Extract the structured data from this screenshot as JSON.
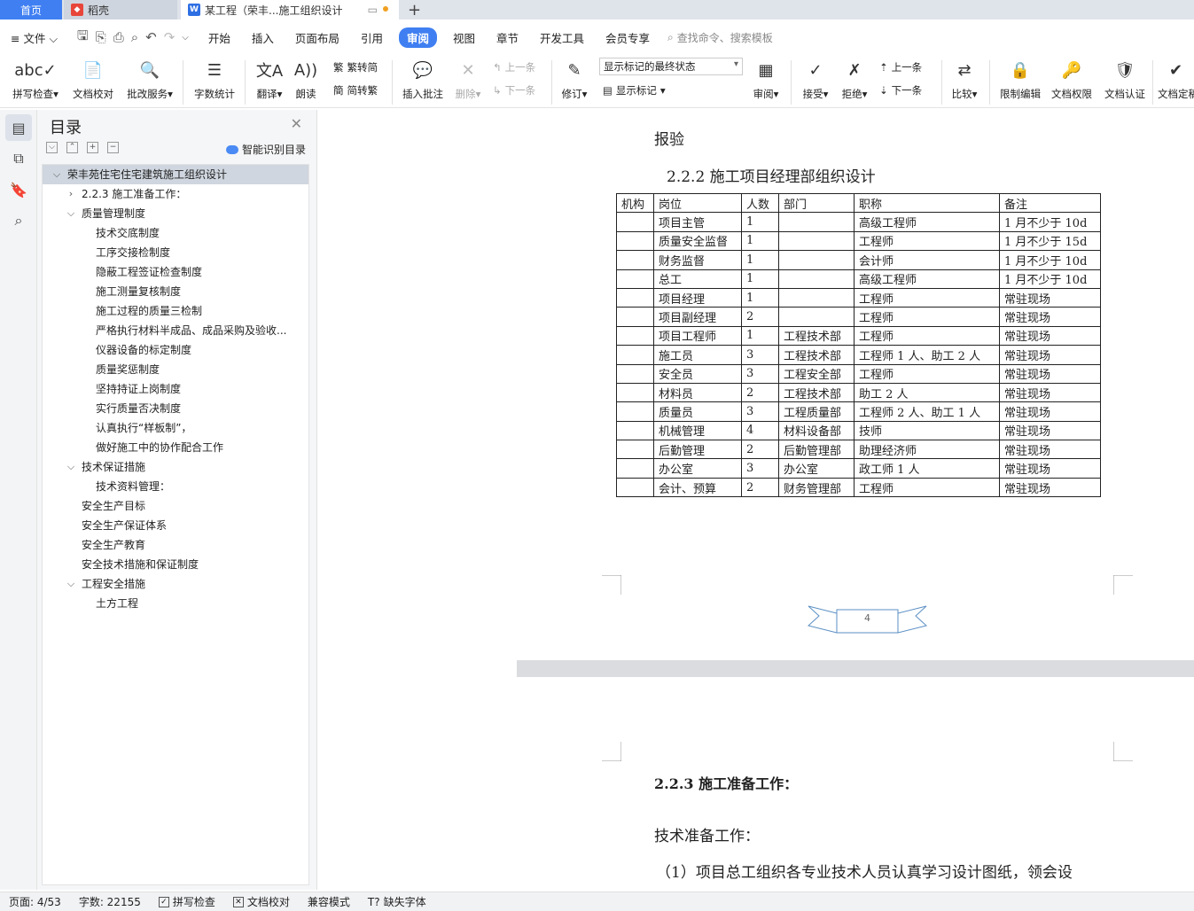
{
  "tabs": {
    "home": "首页",
    "daoke": "稻壳",
    "doc": "某工程（荣丰...施工组织设计",
    "plus": "+"
  },
  "menu": {
    "file": "文件",
    "items": [
      "开始",
      "插入",
      "页面布局",
      "引用",
      "审阅",
      "视图",
      "章节",
      "开发工具",
      "会员专享"
    ],
    "active": "审阅",
    "search_placeholder": "查找命令、搜索模板"
  },
  "ribbon": {
    "spell": "拼写检查",
    "proof": "文档校对",
    "review_service": "批改服务",
    "word_count": "字数统计",
    "translate": "翻译",
    "read_aloud": "朗读",
    "trad_to_simp": "繁转简",
    "simp_to_trad": "简转繁",
    "insert_comment": "插入批注",
    "delete": "删除",
    "prev": "上一条",
    "next": "下一条",
    "track": "修订",
    "markup_combo": "显示标记的最终状态",
    "show_markup": "显示标记",
    "review_pane": "审阅",
    "accept": "接受",
    "reject": "拒绝",
    "prev2": "上一条",
    "next2": "下一条",
    "compare": "比较",
    "restrict_edit": "限制编辑",
    "doc_permission": "文档权限",
    "doc_auth": "文档认证",
    "doc_final": "文档定稿"
  },
  "toc": {
    "title": "目录",
    "smart": "智能识别目录",
    "items": [
      {
        "text": "荣丰苑住宅住宅建筑施工组织设计",
        "level": 0,
        "arrow": "open",
        "selected": true
      },
      {
        "text": "2.2.3 施工准备工作：",
        "level": 1,
        "arrow": "closed"
      },
      {
        "text": "质量管理制度",
        "level": 1,
        "arrow": "open"
      },
      {
        "text": "技术交底制度",
        "level": 2
      },
      {
        "text": "工序交接检制度",
        "level": 2
      },
      {
        "text": "隐蔽工程签证检查制度",
        "level": 2
      },
      {
        "text": "施工测量复核制度",
        "level": 2
      },
      {
        "text": "施工过程的质量三检制",
        "level": 2
      },
      {
        "text": "严格执行材料半成品、成品采购及验收...",
        "level": 2
      },
      {
        "text": "仪器设备的标定制度",
        "level": 2
      },
      {
        "text": "质量奖惩制度",
        "level": 2
      },
      {
        "text": "坚持持证上岗制度",
        "level": 2
      },
      {
        "text": "实行质量否决制度",
        "level": 2
      },
      {
        "text": "认真执行“样板制”，",
        "level": 2
      },
      {
        "text": "做好施工中的协作配合工作",
        "level": 2
      },
      {
        "text": "技术保证措施",
        "level": 1,
        "arrow": "open"
      },
      {
        "text": "技术资料管理：",
        "level": 2
      },
      {
        "text": "安全生产目标",
        "level": 1
      },
      {
        "text": "安全生产保证体系",
        "level": 1
      },
      {
        "text": "安全生产教育",
        "level": 1
      },
      {
        "text": "安全技术措施和保证制度",
        "level": 1
      },
      {
        "text": "工程安全措施",
        "level": 1,
        "arrow": "open"
      },
      {
        "text": "土方工程",
        "level": 2
      }
    ]
  },
  "doc": {
    "line_top": "报验",
    "heading_222": "2.2.2 施工项目经理部组织设计",
    "table": {
      "headers": [
        "机构",
        "岗位",
        "人数",
        "部门",
        "职称",
        "备注"
      ],
      "rows": [
        [
          "",
          "项目主管",
          "1",
          "",
          "高级工程师",
          "1 月不少于 10d"
        ],
        [
          "",
          "质量安全监督",
          "1",
          "",
          "工程师",
          "1 月不少于 15d"
        ],
        [
          "",
          "财务监督",
          "1",
          "",
          "会计师",
          "1 月不少于 10d"
        ],
        [
          "",
          "总工",
          "1",
          "",
          "高级工程师",
          "1 月不少于 10d"
        ],
        [
          "",
          "项目经理",
          "1",
          "",
          "工程师",
          "常驻现场"
        ],
        [
          "",
          "项目副经理",
          "2",
          "",
          "工程师",
          "常驻现场"
        ],
        [
          "",
          "项目工程师",
          "1",
          "工程技术部",
          "工程师",
          "常驻现场"
        ],
        [
          "",
          "施工员",
          "3",
          "工程技术部",
          "工程师 1 人、助工 2 人",
          "常驻现场"
        ],
        [
          "",
          "安全员",
          "3",
          "工程安全部",
          "工程师",
          "常驻现场"
        ],
        [
          "",
          "材料员",
          "2",
          "工程技术部",
          "助工 2 人",
          "常驻现场"
        ],
        [
          "",
          "质量员",
          "3",
          "工程质量部",
          "工程师 2 人、助工 1 人",
          "常驻现场"
        ],
        [
          "",
          "机械管理",
          "4",
          "材料设备部",
          "技师",
          "常驻现场"
        ],
        [
          "",
          "后勤管理",
          "2",
          "后勤管理部",
          "助理经济师",
          "常驻现场"
        ],
        [
          "",
          "办公室",
          "3",
          "办公室",
          "政工师 1 人",
          "常驻现场"
        ],
        [
          "",
          "会计、预算",
          "2",
          "财务管理部",
          "工程师",
          "常驻现场"
        ]
      ]
    },
    "page_number": "4",
    "heading_223": "2.2.3 施工准备工作：",
    "tech_prep": "技术准备工作：",
    "para1": "（1）项目总工组织各专业技术人员认真学习设计图纸，领会设"
  },
  "status": {
    "page": "页面: 4/53",
    "words": "字数: 22155",
    "spell": "拼写检查",
    "proof": "文档校对",
    "compat": "兼容模式",
    "missing_font": "缺失字体"
  },
  "colors": {
    "accent": "#3f7ff2",
    "daoke_red": "#e8463a"
  }
}
